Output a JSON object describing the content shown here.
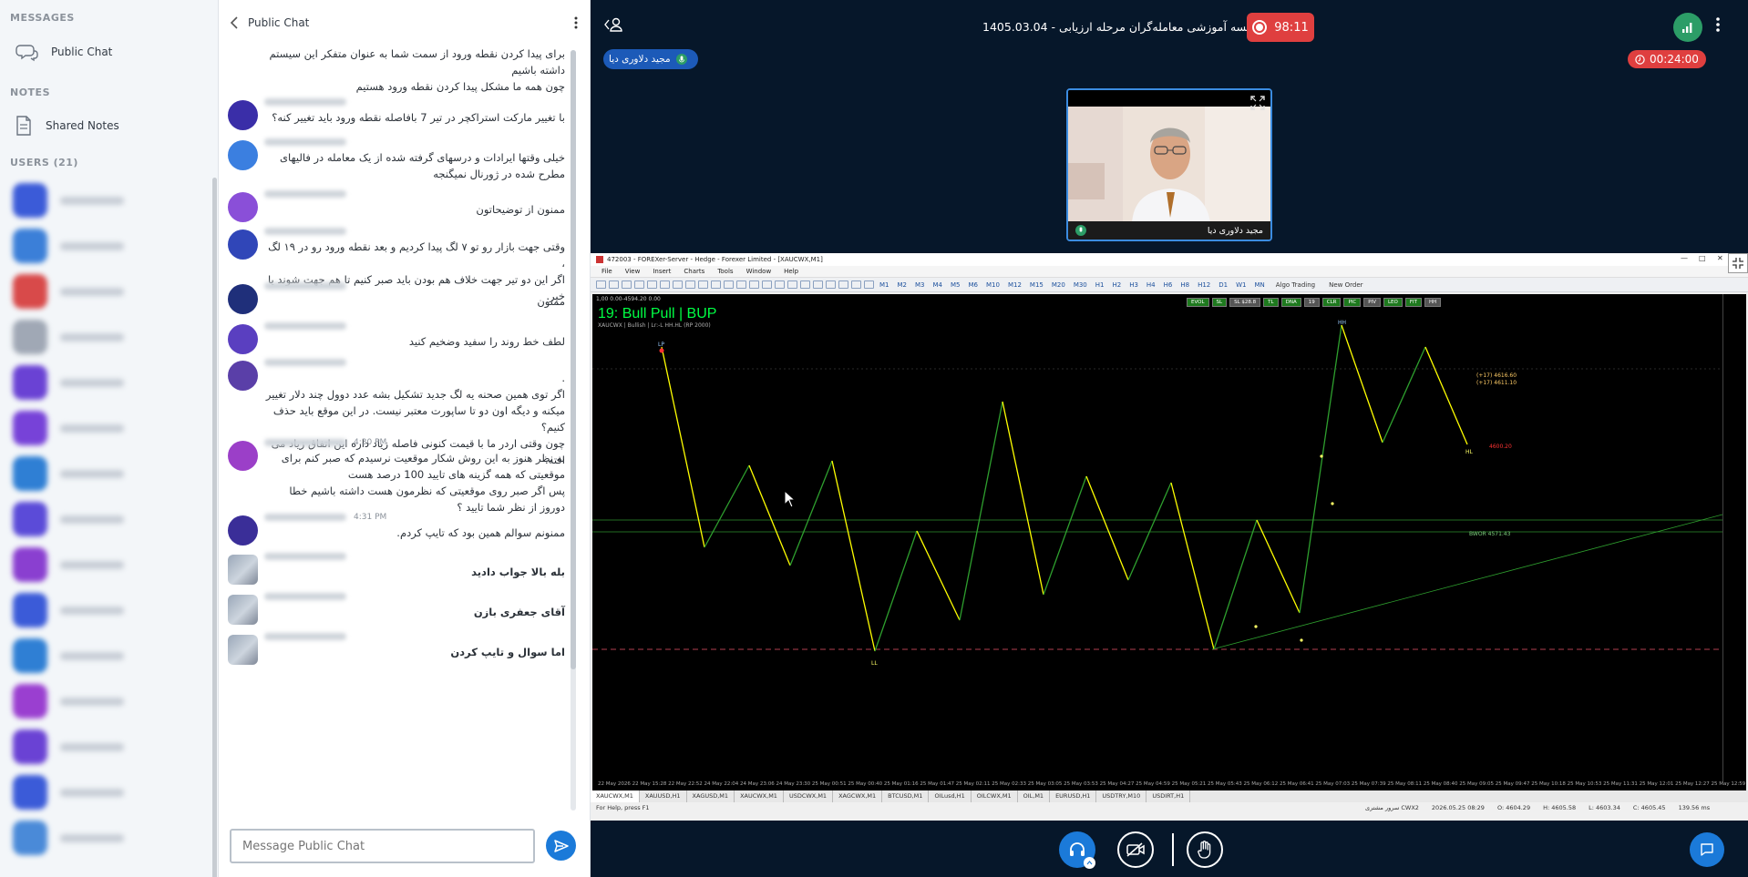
{
  "sidebar": {
    "messages_heading": "MESSAGES",
    "public_chat_label": "Public Chat",
    "notes_heading": "NOTES",
    "shared_notes_label": "Shared Notes",
    "users_heading": "USERS (21)",
    "user_avatar_colors": [
      "#3b5bd8",
      "#3b7fd8",
      "#d84a4a",
      "#a0a8b5",
      "#6a42d4",
      "#7742d8",
      "#2f7fd4",
      "#5b4bd8",
      "#8a3fd0",
      "#3b5bd8",
      "#2f7fd4",
      "#9a3fd0",
      "#6a42d4",
      "#3b5bd8",
      "#4a8ad8"
    ]
  },
  "chat": {
    "title": "Public Chat",
    "placeholder": "Message Public Chat",
    "messages": [
      {
        "avatar_color": null,
        "time": "",
        "lines": [
          "برای پیدا کردن نقطه ورود از سمت شما به عنوان متفکر این سیستم داشته باشیم",
          "چون همه ما مشکل پیدا کردن نقطه ورود هستیم"
        ],
        "style": "normal"
      },
      {
        "avatar_color": "#3a2ea8",
        "time": "",
        "lines": [
          "با تغییر مارکت استراکچر در تیر 7 بافاصله نقطه ورود باید تغییر کنه؟"
        ],
        "style": "normal"
      },
      {
        "avatar_color": "#3b7fe0",
        "time": "",
        "lines": [
          "خیلی وقتها ایرادات و درسهای گرفته شده از یک معامله در فالیهای مطرح شده در ژورنال نمیگنجه"
        ],
        "style": "normal"
      },
      {
        "avatar_color": "#8a4fd8",
        "time": "",
        "lines": [
          "ممنون از توضیحاتون"
        ],
        "style": "normal"
      },
      {
        "avatar_color": "#3046b8",
        "time": "",
        "lines": [
          "وقتی جهت بازار رو تو ۷ لگ پیدا کردیم و بعد نقطه ورود رو در ۱۹ لگ ،",
          "اگر این دو تیر جهت خلاف هم بودن باید صبر کنیم تا هم جهت شوند یا خیر."
        ],
        "style": "normal"
      },
      {
        "avatar_color": "#1f2f7a",
        "time": "",
        "lines": [
          "ممنون"
        ],
        "style": "normal"
      },
      {
        "avatar_color": "#5a3fc0",
        "time": "",
        "lines": [
          "لطف خط روند را سفید وضخیم کنید"
        ],
        "style": "normal"
      },
      {
        "avatar_color": "#5a3fa8",
        "time": "",
        "lines": [
          ".",
          "اگر توی همین صحنه یه لگ جدید تشکیل بشه عدد دوول چند دلار تغییر میکنه و دیگه اون دو تا ساپورت معتبر نیست. در این موقع باید حذف کنیم؟",
          "چون وقتی اردر ما با قیمت کنونی فاصله زیاد داره این اتفاق زیاد می افته."
        ],
        "style": "normal"
      },
      {
        "avatar_color": "#9b3fc8",
        "time": "4:30 PM",
        "lines": [
          "به نظر هنوز به این روش شکار موقعیت نرسیدم که صبر کنم برای موقعیتی که همه گزینه های تایید 100 درصد هست",
          "پس اگر صبر روی موقعیتی که نظرمون هست داشته باشیم خطا دوروز از نظر شما تایید ؟"
        ],
        "style": "normal"
      },
      {
        "avatar_color": "#3a2e98",
        "time": "4:31 PM",
        "lines": [
          "ممنونم سوالم همین بود که تایپ کردم."
        ],
        "style": "normal"
      },
      {
        "avatar_color": "photo",
        "time": "",
        "lines": [
          "بله بالا جواب دادید"
        ],
        "style": "bold"
      },
      {
        "avatar_color": "photo",
        "time": "",
        "lines": [
          "آقای جعفری بازن"
        ],
        "style": "bold"
      },
      {
        "avatar_color": "photo",
        "time": "",
        "lines": [
          "اما سوال و تایپ کردن"
        ],
        "style": "bold"
      }
    ]
  },
  "stage": {
    "meeting_title": "جلسه آموزشی معامله‌گران مرحله ارزیابی - 1405.03.04",
    "recording_time": "98:11",
    "talker_name": "مجید دلاوری دیا",
    "timer": "00:24:00",
    "video_name": "مجید دلاوری دیا",
    "mt": {
      "title": "472003 - FOREXer-Server - Hedge - Forexer Limited - [XAUCWX,M1]",
      "menu": [
        "File",
        "View",
        "Insert",
        "Charts",
        "Tools",
        "Window",
        "Help"
      ],
      "timeframes": [
        "M1",
        "M2",
        "M3",
        "M4",
        "M5",
        "M6",
        "M10",
        "M12",
        "M15",
        "M20",
        "M30",
        "H1",
        "H2",
        "H3",
        "H4",
        "H6",
        "H8",
        "H12",
        "D1",
        "W1",
        "MN"
      ],
      "algo_label": "Algo Trading",
      "new_order_label": "New Order",
      "chart_heading": "19:  Bull Pull | BUP",
      "chart_subheading": "XAUCWX | Bullish | Lr:-L HH.HL (RP 2000)",
      "info_line": "1,00 0.00-4594.20 0.00",
      "price_tag_1": "(+17)  4616.60",
      "price_tag_2": "(+17)  4611.10",
      "price_tag_3": "4600.20",
      "level_label": "BWOR  4571.43",
      "marker_lp": "LP",
      "marker_hh": "HH",
      "marker_ll": "LL",
      "marker_hl": "HL",
      "chart_buttons": [
        "EVOL",
        "SL",
        "SL $28.8",
        "TL",
        "DNA",
        "19",
        "CLR",
        "PIC",
        "PIV",
        "LEO",
        "FIT",
        "HH"
      ],
      "time_axis": "22 May 2026   22 May 15:28   22 May 22:52   24 May 22:04   24 May 23:06   24 May 23:30   25 May 00:51   25 May 00:40   25 May 01:16   25 May 01:47   25 May 02:11   25 May 02:33   25 May 03:05   25 May 03:53   25 May 04:27   25 May 04:59   25 May 05:21   25 May 05:43   25 May 06:12   25 May 06:41   25 May 07:03   25 May 07:39   25 May 08:11   25 May 08:40   25 May 09:05   25 May 09:47   25 May 10:18   25 May 10:53   25 May 11:31   25 May 12:01   25 May 12:27   25 May 12:59",
      "symbol_tabs": [
        "XAUCWX,M1",
        "XAUUSD,H1",
        "XAGUSD,M1",
        "XAUCWX,M1",
        "USDCWX,M1",
        "XAGCWX,M1",
        "BTCUSD,M1",
        "OILusd,H1",
        "OILCWX,M1",
        "OIL,M1",
        "EURUSD,H1",
        "USDTRY,M10",
        "USDIRT,H1"
      ],
      "status_left": "For Help, press F1",
      "status_profile": "سرور مشتری CWX2",
      "status_time": "2026.05.25 08:29",
      "status_open": "O: 4604.29",
      "status_high": "H: 4605.58",
      "status_low": "L: 4603.34",
      "status_close": "C: 4605.45",
      "status_kb": "139.56 ms"
    }
  },
  "colors": {
    "accent": "#1b7ad9",
    "record": "#df3f3f",
    "chart_up": "#ffff00",
    "chart_down": "#2e9f2e",
    "heading_green": "#00ff44"
  }
}
